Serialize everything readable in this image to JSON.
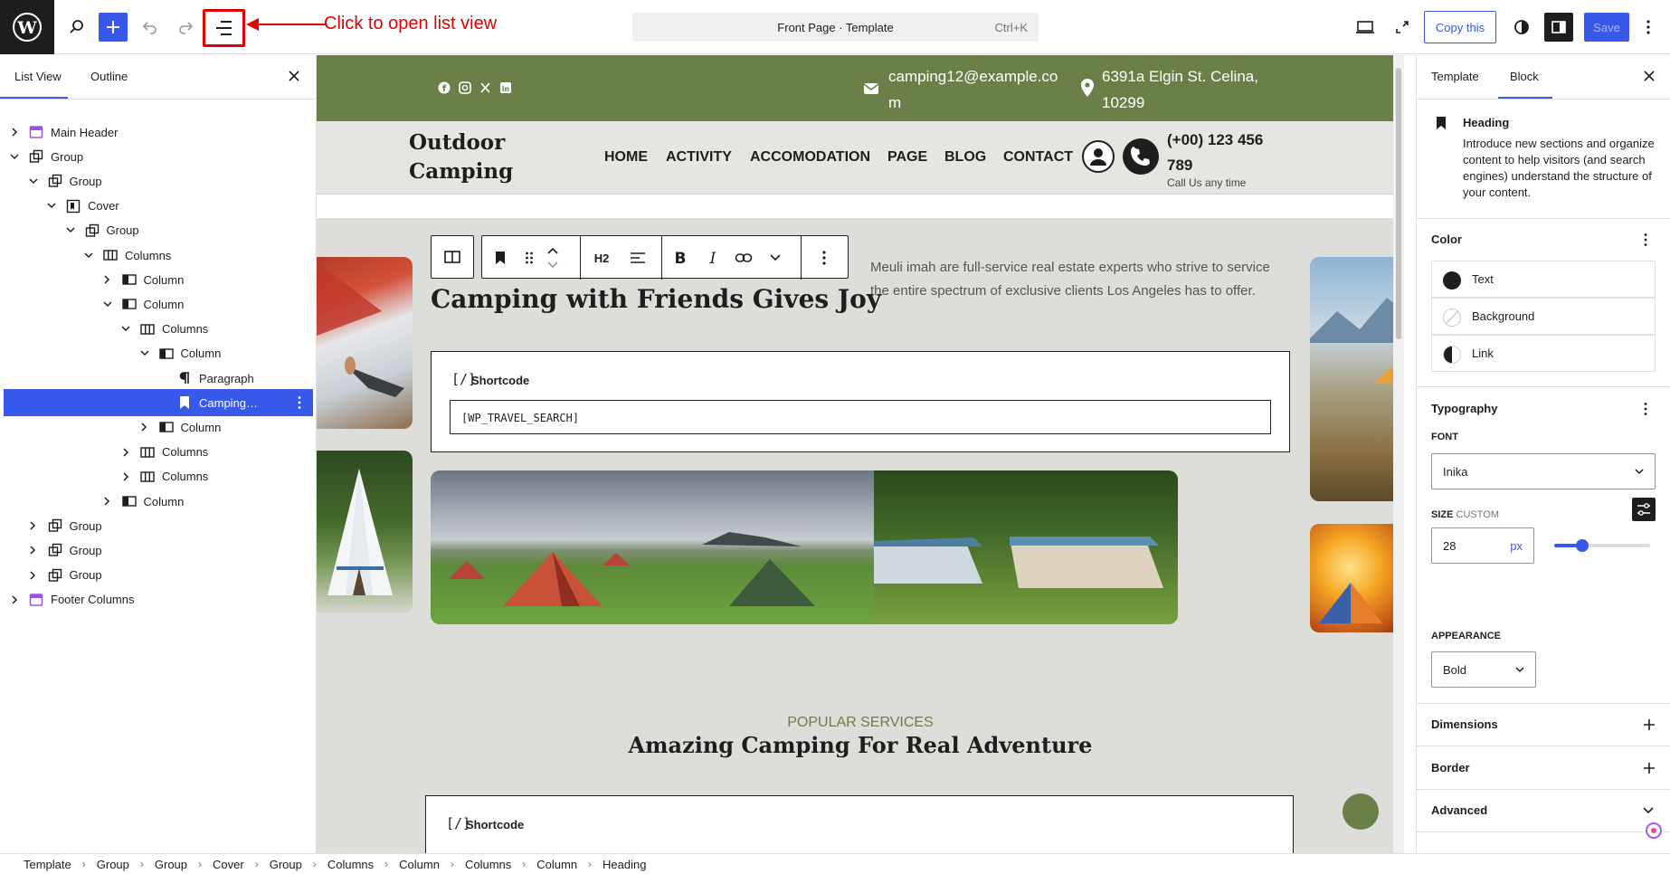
{
  "topbar": {
    "annotation": "Click to open list view",
    "document_title": "Front Page · Template",
    "shortcut": "Ctrl+K",
    "copy_label": "Copy this",
    "save_label": "Save"
  },
  "left_panel": {
    "tabs": [
      "List View",
      "Outline"
    ],
    "tree": [
      {
        "label": "Main Header",
        "depth": 0,
        "icon": "template-part-icon",
        "chevron": "right"
      },
      {
        "label": "Group",
        "depth": 0,
        "icon": "group-icon",
        "chevron": "down"
      },
      {
        "label": "Group",
        "depth": 1,
        "icon": "group-icon",
        "chevron": "down"
      },
      {
        "label": "Cover",
        "depth": 2,
        "icon": "cover-icon",
        "chevron": "down"
      },
      {
        "label": "Group",
        "depth": 3,
        "icon": "group-icon",
        "chevron": "down"
      },
      {
        "label": "Columns",
        "depth": 4,
        "icon": "columns-icon",
        "chevron": "down"
      },
      {
        "label": "Column",
        "depth": 5,
        "icon": "column-icon",
        "chevron": "right"
      },
      {
        "label": "Column",
        "depth": 5,
        "icon": "column-icon",
        "chevron": "down"
      },
      {
        "label": "Columns",
        "depth": 6,
        "icon": "columns-icon",
        "chevron": "down"
      },
      {
        "label": "Column",
        "depth": 7,
        "icon": "column-icon",
        "chevron": "down"
      },
      {
        "label": "Paragraph",
        "depth": 8,
        "icon": "paragraph-icon",
        "chevron": "none"
      },
      {
        "label": "Camping…",
        "depth": 8,
        "icon": "heading-icon",
        "chevron": "none",
        "selected": true
      },
      {
        "label": "Column",
        "depth": 7,
        "icon": "column-icon",
        "chevron": "right"
      },
      {
        "label": "Columns",
        "depth": 6,
        "icon": "columns-icon",
        "chevron": "right"
      },
      {
        "label": "Columns",
        "depth": 6,
        "icon": "columns-icon",
        "chevron": "right"
      },
      {
        "label": "Column",
        "depth": 5,
        "icon": "column-icon",
        "chevron": "right"
      },
      {
        "label": "Group",
        "depth": 1,
        "icon": "group-icon",
        "chevron": "right"
      },
      {
        "label": "Group",
        "depth": 1,
        "icon": "group-icon",
        "chevron": "right"
      },
      {
        "label": "Group",
        "depth": 1,
        "icon": "group-icon",
        "chevron": "right"
      },
      {
        "label": "Footer Columns",
        "depth": 0,
        "icon": "template-part-icon",
        "chevron": "right"
      }
    ]
  },
  "canvas": {
    "topbar": {
      "email": [
        "camping12@example.co",
        "m"
      ],
      "address": [
        "6391a Elgin St. Celina,",
        "10299"
      ]
    },
    "site_title": [
      "Outdoor",
      "Camping"
    ],
    "nav": [
      "HOME",
      "ACTIVITY",
      "ACCOMODATION",
      "PAGE",
      "BLOG",
      "CONTACT"
    ],
    "phone": [
      "(+00) 123 456",
      "789"
    ],
    "phone_sub": "Call Us any time",
    "toolbar_heading_level": "H2",
    "heading": "Camping with Friends Gives Joy",
    "description": "Meuli imah are full-service real estate experts who strive to service the entire spectrum of exclusive clients Los Angeles has to offer.",
    "shortcode_label": "Shortcode",
    "shortcode_value": "[WP_TRAVEL_SEARCH]",
    "services_label": "POPULAR SERVICES",
    "services_title": "Amazing Camping For Real Adventure",
    "shortcode_label_2": "Shortcode"
  },
  "right_panel": {
    "tabs": [
      "Template",
      "Block"
    ],
    "block_name": "Heading",
    "block_desc": "Introduce new sections and organize content to help visitors (and search engines) understand the structure of your content.",
    "color_title": "Color",
    "colors": [
      "Text",
      "Background",
      "Link"
    ],
    "typography_title": "Typography",
    "font_label": "FONT",
    "font_value": "Inika",
    "size_label": "SIZE",
    "size_custom": "CUSTOM",
    "size_value": "28",
    "size_unit": "px",
    "appearance_label": "APPEARANCE",
    "appearance_value": "Bold",
    "dimensions": "Dimensions",
    "border": "Border",
    "advanced": "Advanced"
  },
  "breadcrumbs": [
    "Template",
    "Group",
    "Group",
    "Cover",
    "Group",
    "Columns",
    "Column",
    "Columns",
    "Column",
    "Heading"
  ],
  "colors": {
    "accent": "#3858e9",
    "green": "#6b8049",
    "annotation": "#e00000"
  }
}
